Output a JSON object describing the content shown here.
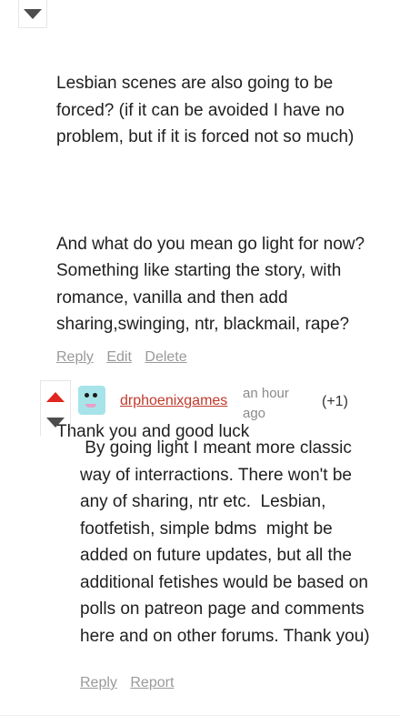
{
  "parent_comment": {
    "paragraphs": [
      "Lesbian scenes are also going to be forced? (if it can be avoided I have no problem, but if it is forced not so much)",
      "And what do you mean go light for now? Something like starting the story, with romance, vanilla and then add sharing,swinging, ntr, blackmail, rape?",
      "Thank you and good luck"
    ],
    "actions": {
      "reply": "Reply",
      "edit": "Edit",
      "delete": "Delete"
    }
  },
  "reply_comment": {
    "username": "drphoenixgames",
    "timestamp": "an hour ago",
    "score": "(+1)",
    "text": " By going light I meant more classic way of interractions. There won't be any of sharing, ntr etc.  Lesbian, footfetish, simple bdms  might be added on future updates, but all the additional fetishes would be based on polls on patreon page and comments here and on other forums. Thank you)",
    "actions": {
      "reply": "Reply",
      "report": "Report"
    }
  },
  "icons": {
    "upvote": "upvote-arrow-icon",
    "downvote": "downvote-arrow-icon",
    "avatar": "user-avatar"
  },
  "colors": {
    "username": "#c0392b",
    "upvote_active": "#e0261f",
    "downvote": "#4d4d4d",
    "action_link": "#9a9a9a"
  }
}
